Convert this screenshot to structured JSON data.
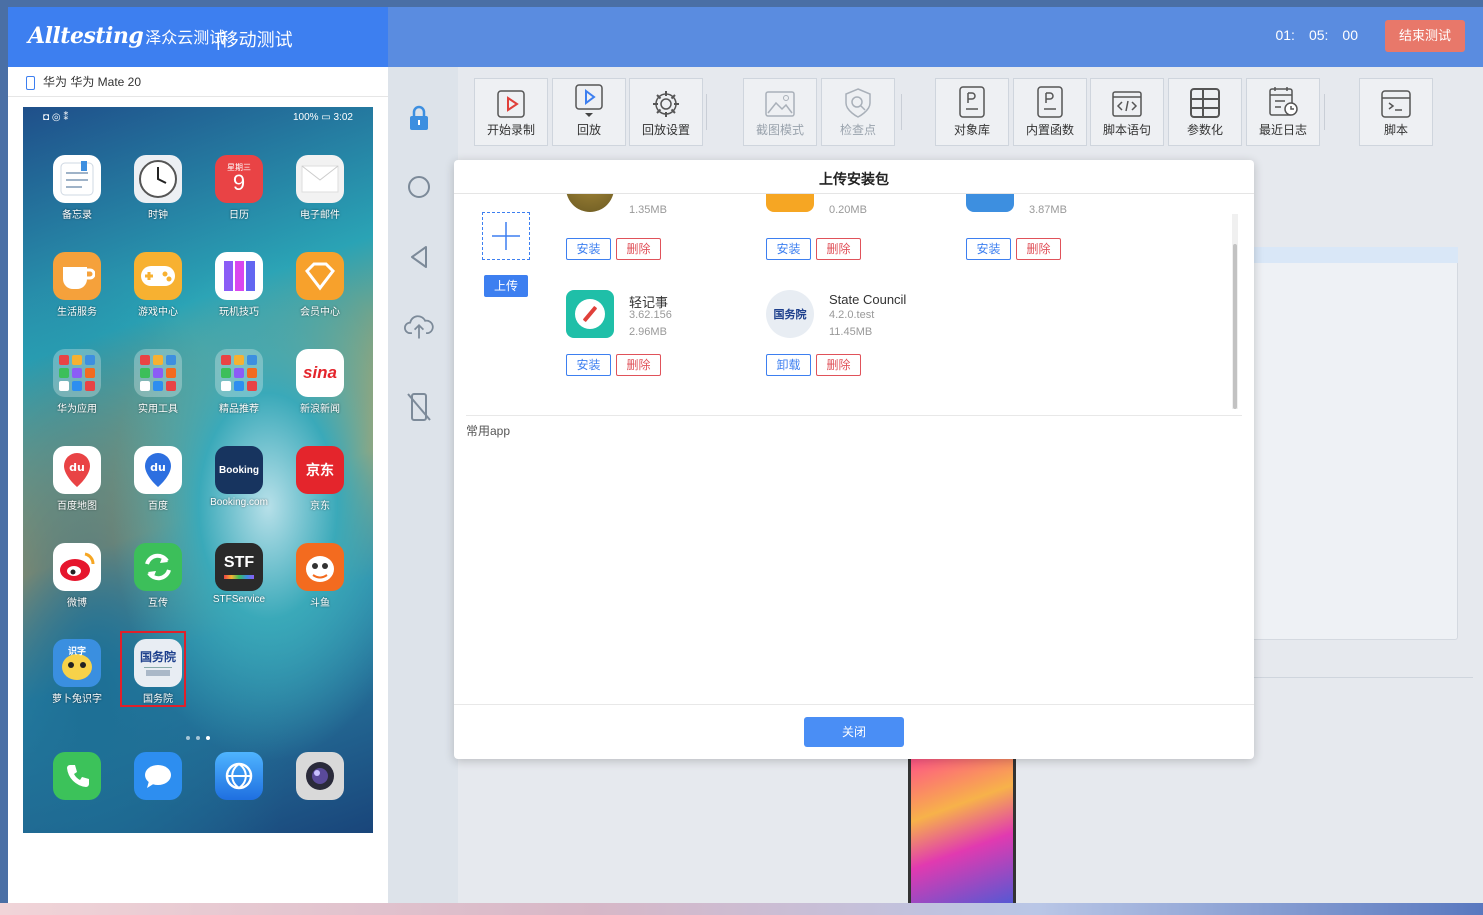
{
  "header": {
    "brand": "Alltesting",
    "brand_cn": "泽众云测试",
    "title": "|移动测试",
    "timer": {
      "h": "01:",
      "m": "05:",
      "s": "00"
    },
    "end_button": "结束测试"
  },
  "device": {
    "name": "华为 华为 Mate 20",
    "status_left": "◘ ◎ ⁑",
    "status_right": "100% ▭ 3:02",
    "apps": [
      {
        "label": "备忘录",
        "icon": "memo-icon",
        "color": "#ffffff"
      },
      {
        "label": "时钟",
        "icon": "clock-icon",
        "color": "#eceff3"
      },
      {
        "label": "日历",
        "icon": "calendar-icon",
        "color": "#e94345",
        "text": "9",
        "sub": "星期三"
      },
      {
        "label": "电子邮件",
        "icon": "mail-icon",
        "color": "#f2f2f2"
      },
      {
        "label": "生活服务",
        "icon": "cup-icon",
        "color": "#f5a13b"
      },
      {
        "label": "游戏中心",
        "icon": "gamepad-icon",
        "color": "#f7b131"
      },
      {
        "label": "玩机技巧",
        "icon": "book-icon",
        "color": "#8b5cf6"
      },
      {
        "label": "会员中心",
        "icon": "diamond-icon",
        "color": "#f7a12c"
      },
      {
        "label": "华为应用",
        "icon": "folder-icon",
        "color": "#6aa8c9"
      },
      {
        "label": "实用工具",
        "icon": "folder-icon",
        "color": "#6aa8c9"
      },
      {
        "label": "精品推荐",
        "icon": "folder-icon",
        "color": "#6aa8c9"
      },
      {
        "label": "新浪新闻",
        "icon": "sina-icon",
        "color": "#ffffff",
        "text": "sina"
      },
      {
        "label": "百度地图",
        "icon": "map-pin-icon",
        "color": "#ffffff",
        "text": "du"
      },
      {
        "label": "百度",
        "icon": "paw-icon",
        "color": "#ffffff",
        "text": "du"
      },
      {
        "label": "Booking.com",
        "icon": "booking-icon",
        "color": "#17345f",
        "text": "Booking"
      },
      {
        "label": "京东",
        "icon": "jd-icon",
        "color": "#e4252c",
        "text": "京东"
      },
      {
        "label": "微博",
        "icon": "weibo-icon",
        "color": "#f6a623"
      },
      {
        "label": "互传",
        "icon": "transfer-icon",
        "color": "#3cbf5a"
      },
      {
        "label": "STFService",
        "icon": "stf-icon",
        "color": "#2a2a2a",
        "text": "STF"
      },
      {
        "label": "斗鱼",
        "icon": "douyu-icon",
        "color": "#f36b1f"
      },
      {
        "label": "萝卜兔识字",
        "icon": "bunny-icon",
        "color": "#3a8fe0",
        "text": "识字"
      },
      {
        "label": "国务院",
        "icon": "state-council-icon",
        "color": "#e8edf3",
        "text": "国务院"
      }
    ],
    "dock": [
      {
        "icon": "phone-icon",
        "color": "#3cc25a"
      },
      {
        "icon": "message-icon",
        "color": "#2d8ef0"
      },
      {
        "icon": "browser-icon",
        "color": "#2d8ef0"
      },
      {
        "icon": "camera-icon",
        "color": "#d9d9d9"
      }
    ]
  },
  "toolbar": [
    {
      "label": "开始录制",
      "icon": "record-icon",
      "disabled": false
    },
    {
      "label": "回放",
      "icon": "playback-icon",
      "disabled": false
    },
    {
      "label": "回放设置",
      "icon": "gear-icon",
      "disabled": false
    },
    {
      "label": "截图模式",
      "icon": "image-icon",
      "disabled": true
    },
    {
      "label": "检查点",
      "icon": "checkpoint-icon",
      "disabled": true
    },
    {
      "label": "对象库",
      "icon": "object-library-icon",
      "disabled": false
    },
    {
      "label": "内置函数",
      "icon": "function-icon",
      "disabled": false
    },
    {
      "label": "脚本语句",
      "icon": "code-icon",
      "disabled": false
    },
    {
      "label": "参数化",
      "icon": "grid-icon",
      "disabled": false
    },
    {
      "label": "最近日志",
      "icon": "log-icon",
      "disabled": false
    },
    {
      "label": "脚本",
      "icon": "terminal-icon",
      "disabled": false
    }
  ],
  "modal": {
    "title": "上传安装包",
    "upload_label": "上传",
    "partial_sizes": [
      "1.35MB",
      "0.20MB",
      "3.87MB"
    ],
    "packages": [
      {
        "name": "轻记事",
        "version": "3.62.156",
        "size": "2.96MB",
        "primary": "安装",
        "delete": "删除"
      },
      {
        "name": "State Council",
        "version": "4.2.0.test",
        "size": "11.45MB",
        "primary": "卸载",
        "delete": "删除"
      }
    ],
    "top_row_buttons": {
      "primary": "安装",
      "delete": "删除"
    },
    "section_label": "常用app",
    "close_label": "关闭"
  },
  "colors": {
    "accent": "#3d7ff0",
    "danger": "#e0525a",
    "end": "#e8786a"
  }
}
